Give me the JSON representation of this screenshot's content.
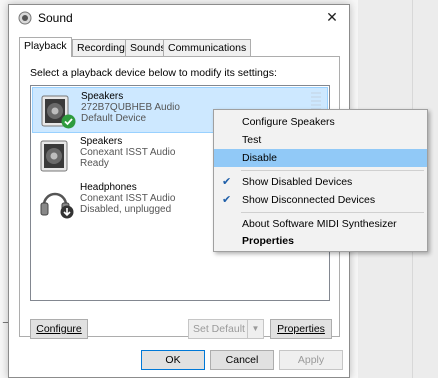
{
  "window": {
    "title": "Sound",
    "close_glyph": "✕"
  },
  "tabs": [
    "Playback",
    "Recording",
    "Sounds",
    "Communications"
  ],
  "instruction": "Select a playback device below to modify its settings:",
  "devices": [
    {
      "name": "Speakers",
      "line2": "272B7QUBHEB Audio",
      "line3": "Default Device",
      "icon": "speaker-icon",
      "badge": "green-check-badge-icon"
    },
    {
      "name": "Speakers",
      "line2": "Conexant ISST Audio",
      "line3": "Ready",
      "icon": "speaker-icon"
    },
    {
      "name": "Headphones",
      "line2": "Conexant ISST Audio",
      "line3": "Disabled, unplugged",
      "icon": "headphones-icon",
      "badge": "down-arrow-badge-icon"
    }
  ],
  "buttons": {
    "configure": "Configure",
    "set_default": "Set Default",
    "properties": "Properties",
    "ok": "OK",
    "cancel": "Cancel",
    "apply": "Apply"
  },
  "context_menu": {
    "configure_speakers": "Configure Speakers",
    "test": "Test",
    "disable": "Disable",
    "show_disabled": "Show Disabled Devices",
    "show_disconnected": "Show Disconnected Devices",
    "about_midi": "About Software MIDI Synthesizer",
    "properties": "Properties",
    "check_glyph": "✔"
  },
  "edge_glyph": "⊣",
  "colors": {
    "selection": "#cde8ff",
    "menu_hover": "#91c9f7",
    "check": "#1e5ea8",
    "badge_green": "#2e9b3e"
  }
}
